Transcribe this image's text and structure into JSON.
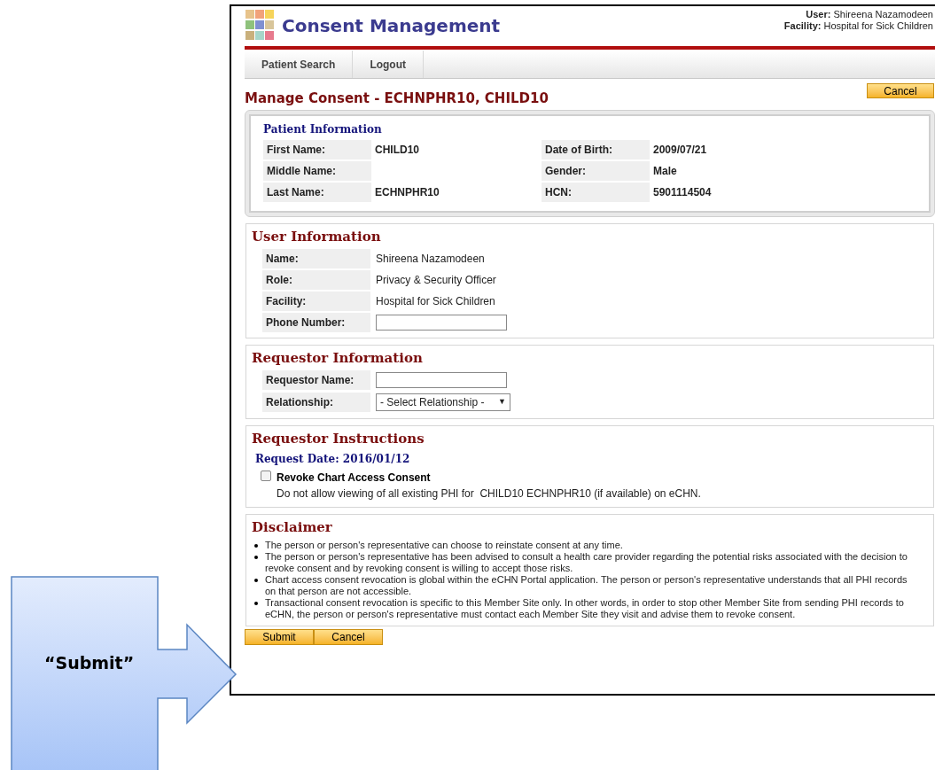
{
  "header": {
    "app_title": "Consent Management",
    "user_label": "User:",
    "user_value": "Shireena Nazamodeen",
    "facility_label": "Facility:",
    "facility_value": "Hospital for Sick Children"
  },
  "nav": [
    "Patient Search",
    "Logout"
  ],
  "page_title": "Manage Consent - ECHNPHR10, CHILD10",
  "top_cancel": "Cancel",
  "patient_info": {
    "title": "Patient Information",
    "rows": [
      {
        "left": {
          "label": "First Name:",
          "value": "CHILD10"
        },
        "right": {
          "label": "Date of Birth:",
          "value": "2009/07/21"
        }
      },
      {
        "left": {
          "label": "Middle Name:"
        },
        "right": {
          "label": "Gender:",
          "value": "Male"
        }
      },
      {
        "left": {
          "label": "Last Name:",
          "value": "ECHNPHR10"
        },
        "right": {
          "label": "HCN:",
          "value": "5901114504"
        }
      }
    ]
  },
  "user_info": {
    "title": "User Information",
    "rows": [
      {
        "label": "Name:",
        "kind": "text",
        "value": "Shireena Nazamodeen"
      },
      {
        "label": "Role:",
        "kind": "text",
        "value": "Privacy & Security Officer"
      },
      {
        "label": "Facility:",
        "kind": "text",
        "value": "Hospital for Sick Children"
      },
      {
        "label": "Phone Number:",
        "kind": "input"
      }
    ]
  },
  "requestor_info": {
    "title": "Requestor Information",
    "rows": [
      {
        "label": "Requestor Name:",
        "kind": "input"
      },
      {
        "label": "Relationship:",
        "kind": "select",
        "value": "- Select Relationship -",
        "arrow": "▼"
      }
    ]
  },
  "instructions": {
    "title": "Requestor Instructions",
    "date_label": "Request Date:",
    "date_value": "2016/01/12",
    "option": {
      "label": "Revoke Chart Access Consent",
      "checked": false,
      "description": "Do not allow viewing of all existing PHI for  CHILD10 ECHNPHR10 (if available) on eCHN."
    }
  },
  "disclaimer": {
    "title": "Disclaimer",
    "items": [
      "The person or person's representative can choose to reinstate consent at any time.",
      "The person or person's representative has been advised to consult a health care provider regarding the potential risks associated with the decision to revoke consent and by revoking consent is willing to accept those risks.",
      "Chart access consent revocation is global within the eCHN Portal application. The person or person's representative understands that all PHI records on that person are not accessible.",
      "Transactional consent revocation is specific to this Member Site only. In other words, in order to stop other Member Site from sending PHI records to eCHN, the person or person's representative must contact each Member Site they visit and advise them to revoke consent."
    ]
  },
  "buttons": [
    "Submit",
    "Cancel"
  ],
  "callout": {
    "text": "“Submit”"
  }
}
